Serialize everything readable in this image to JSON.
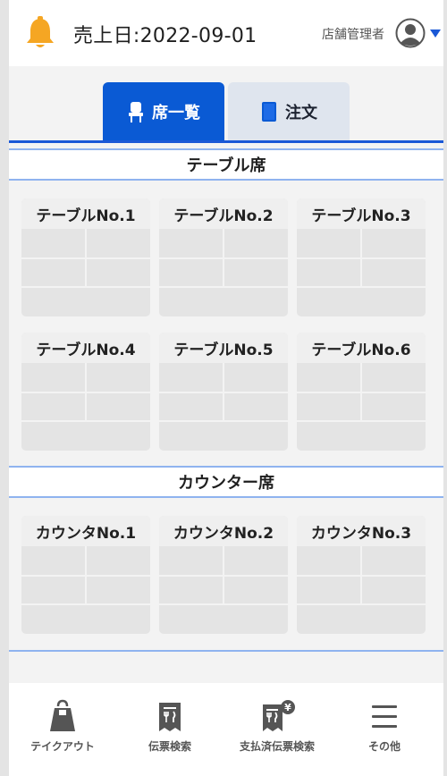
{
  "header": {
    "sales_date": "売上日:2022-09-01",
    "role": "店舗管理者",
    "bell_icon": "bell-icon",
    "avatar_icon": "user-avatar-icon",
    "accent_color": "#f5a623"
  },
  "tabs": [
    {
      "label": "席一覧",
      "icon": "chair-icon",
      "active": true
    },
    {
      "label": "注文",
      "icon": "book-icon",
      "active": false
    }
  ],
  "sections": {
    "table_title": "テーブル席",
    "counter_title": "カウンター席"
  },
  "tables": [
    "テーブルNo.1",
    "テーブルNo.2",
    "テーブルNo.3",
    "テーブルNo.4",
    "テーブルNo.5",
    "テーブルNo.6"
  ],
  "counters": [
    "カウンタNo.1",
    "カウンタNo.2",
    "カウンタNo.3"
  ],
  "bottom_nav": [
    {
      "label": "テイクアウト",
      "icon": "takeout-bag-icon"
    },
    {
      "label": "伝票検索",
      "icon": "receipt-search-icon"
    },
    {
      "label": "支払済伝票検索",
      "icon": "paid-receipt-icon"
    },
    {
      "label": "その他",
      "icon": "menu-icon"
    }
  ],
  "colors": {
    "primary": "#0a5ad4",
    "divider": "#8fb3ef"
  }
}
